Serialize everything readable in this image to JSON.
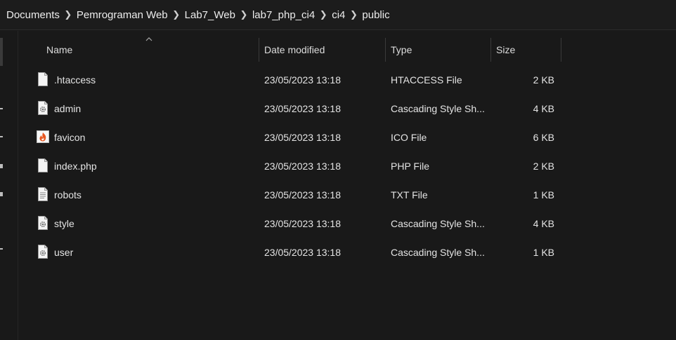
{
  "breadcrumb": [
    "Documents",
    "Pemrograman Web",
    "Lab7_Web",
    "lab7_php_ci4",
    "ci4",
    "public"
  ],
  "columns": {
    "name": "Name",
    "date": "Date modified",
    "type": "Type",
    "size": "Size"
  },
  "files": [
    {
      "name": ".htaccess",
      "date": "23/05/2023 13:18",
      "type": "HTACCESS File",
      "size": "2 KB",
      "icon": "blank-file-icon"
    },
    {
      "name": "admin",
      "date": "23/05/2023 13:18",
      "type": "Cascading Style Sh...",
      "size": "4 KB",
      "icon": "css-file-icon"
    },
    {
      "name": "favicon",
      "date": "23/05/2023 13:18",
      "type": "ICO File",
      "size": "6 KB",
      "icon": "codeigniter-flame-icon"
    },
    {
      "name": "index.php",
      "date": "23/05/2023 13:18",
      "type": "PHP File",
      "size": "2 KB",
      "icon": "blank-file-icon"
    },
    {
      "name": "robots",
      "date": "23/05/2023 13:18",
      "type": "TXT File",
      "size": "1 KB",
      "icon": "text-file-icon"
    },
    {
      "name": "style",
      "date": "23/05/2023 13:18",
      "type": "Cascading Style Sh...",
      "size": "4 KB",
      "icon": "css-file-icon"
    },
    {
      "name": "user",
      "date": "23/05/2023 13:18",
      "type": "Cascading Style Sh...",
      "size": "1 KB",
      "icon": "css-file-icon"
    }
  ],
  "colors": {
    "background": "#191919",
    "text": "#e4e4e4",
    "flame": "#e8561f"
  }
}
